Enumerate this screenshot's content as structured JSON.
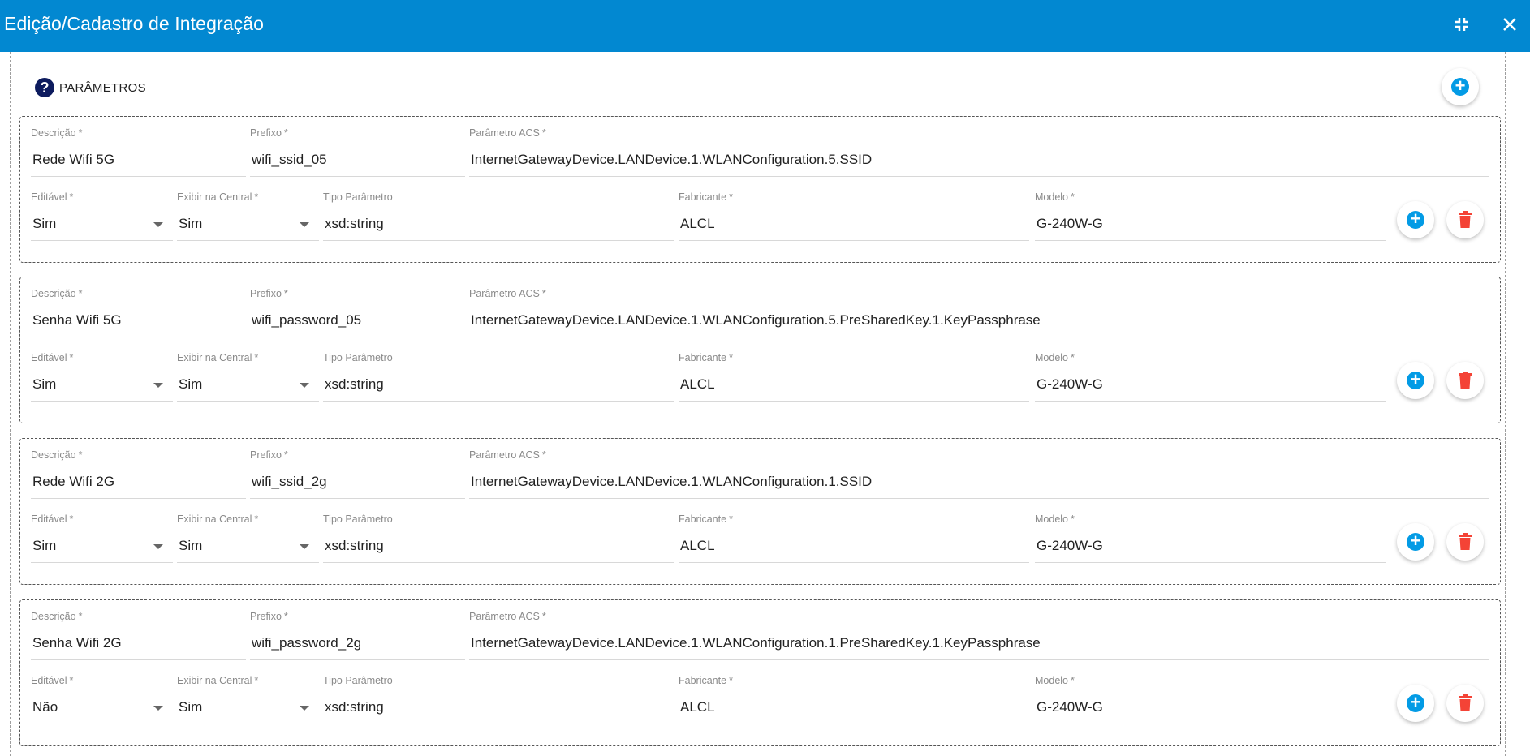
{
  "header": {
    "title": "Edição/Cadastro de Integração"
  },
  "section": {
    "title": "PARÂMETROS"
  },
  "labels": {
    "descricao": "Descrição",
    "prefixo": "Prefixo",
    "parametro_acs": "Parâmetro ACS",
    "editavel": "Editável",
    "exibir_na_central": "Exibir na Central",
    "tipo_parametro": "Tipo Parâmetro",
    "fabricante": "Fabricante",
    "modelo": "Modelo",
    "required_mark": "*"
  },
  "icons": {
    "header_minimize": "fullscreen-exit-icon",
    "header_close": "close-icon",
    "section_help": "help-circle-icon",
    "add": "add-circle-icon",
    "delete": "delete-icon"
  },
  "colors": {
    "header": "#0288d1",
    "add": "#039be5",
    "delete": "#f44336",
    "help": "#0d1b5e"
  },
  "params": [
    {
      "descricao": "Rede Wifi 5G",
      "prefixo": "wifi_ssid_05",
      "parametro_acs": "InternetGatewayDevice.LANDevice.1.WLANConfiguration.5.SSID",
      "editavel": "Sim",
      "exibir_na_central": "Sim",
      "tipo_parametro": "xsd:string",
      "fabricante": "ALCL",
      "modelo": "G-240W-G"
    },
    {
      "descricao": "Senha Wifi 5G",
      "prefixo": "wifi_password_05",
      "parametro_acs": "InternetGatewayDevice.LANDevice.1.WLANConfiguration.5.PreSharedKey.1.KeyPassphrase",
      "editavel": "Sim",
      "exibir_na_central": "Sim",
      "tipo_parametro": "xsd:string",
      "fabricante": "ALCL",
      "modelo": "G-240W-G"
    },
    {
      "descricao": "Rede Wifi 2G",
      "prefixo": "wifi_ssid_2g",
      "parametro_acs": "InternetGatewayDevice.LANDevice.1.WLANConfiguration.1.SSID",
      "editavel": "Sim",
      "exibir_na_central": "Sim",
      "tipo_parametro": "xsd:string",
      "fabricante": "ALCL",
      "modelo": "G-240W-G"
    },
    {
      "descricao": "Senha Wifi 2G",
      "prefixo": "wifi_password_2g",
      "parametro_acs": "InternetGatewayDevice.LANDevice.1.WLANConfiguration.1.PreSharedKey.1.KeyPassphrase",
      "editavel": "Não",
      "exibir_na_central": "Sim",
      "tipo_parametro": "xsd:string",
      "fabricante": "ALCL",
      "modelo": "G-240W-G"
    }
  ]
}
